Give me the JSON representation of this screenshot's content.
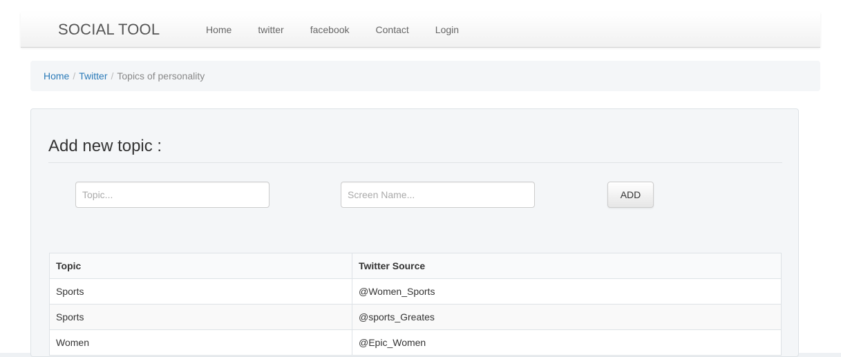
{
  "navbar": {
    "brand": "SOCIAL TOOL",
    "links": [
      "Home",
      "twitter",
      "facebook",
      "Contact",
      "Login"
    ]
  },
  "breadcrumb": {
    "items": [
      "Home",
      "Twitter"
    ],
    "separator": "/",
    "active": "Topics of personality"
  },
  "form": {
    "title": "Add new topic :",
    "topic_placeholder": "Topic...",
    "screen_name_placeholder": "Screen Name...",
    "add_label": "ADD"
  },
  "table": {
    "headers": [
      "Topic",
      "Twitter Source"
    ],
    "rows": [
      [
        "Sports",
        "@Women_Sports"
      ],
      [
        "Sports",
        "@sports_Greates"
      ],
      [
        "Women",
        "@Epic_Women"
      ]
    ]
  },
  "colors": {
    "link": "#2a7ab8",
    "panel": "#f4f6f8"
  }
}
